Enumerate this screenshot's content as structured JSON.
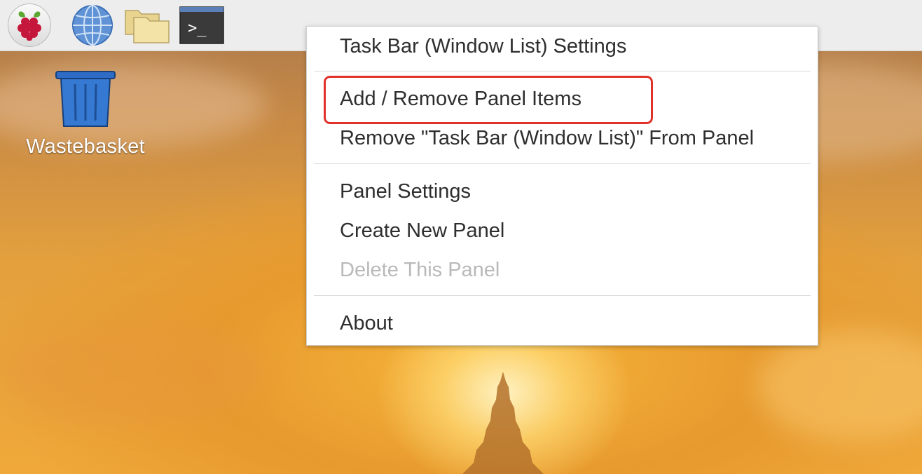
{
  "desktop": {
    "icons": [
      {
        "label": "Wastebasket",
        "icon": "trash-icon"
      }
    ]
  },
  "panel": {
    "launchers": [
      {
        "icon": "raspberry-menu-icon"
      },
      {
        "icon": "globe-icon"
      },
      {
        "icon": "folder-icon"
      },
      {
        "icon": "terminal-icon",
        "glyph": ">_"
      }
    ]
  },
  "context_menu": {
    "items": [
      {
        "label": "Task Bar (Window List) Settings",
        "enabled": true
      },
      {
        "label": "Add / Remove Panel Items",
        "enabled": true,
        "highlighted": true
      },
      {
        "label": "Remove \"Task Bar (Window List)\" From Panel",
        "enabled": true
      },
      {
        "label": "Panel Settings",
        "enabled": true
      },
      {
        "label": "Create New Panel",
        "enabled": true
      },
      {
        "label": "Delete This Panel",
        "enabled": false
      },
      {
        "label": "About",
        "enabled": true
      }
    ]
  },
  "colors": {
    "highlight_border": "#e0322b",
    "panel_bg": "#ededed",
    "menu_text": "#2e2e2e",
    "menu_text_disabled": "#b9b9b9"
  }
}
